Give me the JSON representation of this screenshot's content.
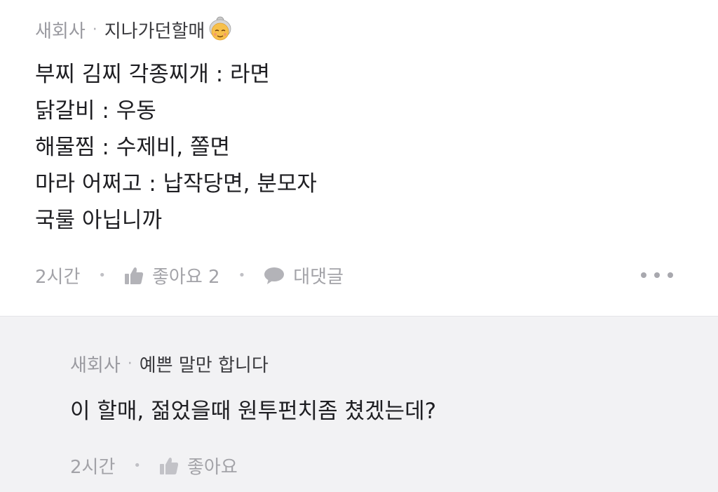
{
  "comment": {
    "company": "새회사",
    "nickname": "지나가던할매",
    "nickname_icon": "old-woman-emoji",
    "lines": [
      "부찌 김찌 각종찌개 : 라면",
      "닭갈비 : 우동",
      "해물찜 : 수제비, 쫄면",
      "마라 어쩌고 : 납작당면, 분모자",
      "국룰 아닙니까"
    ],
    "time": "2시간",
    "like_label": "좋아요 2",
    "reply_label": "대댓글"
  },
  "reply": {
    "company": "새회사",
    "nickname": "예쁜 말만 합니다",
    "text": "이 할매, 젊었을때 원투펀치좀 쳤겠는데?",
    "time": "2시간",
    "like_label": "좋아요"
  },
  "colors": {
    "reply_background": "#f2f2f4",
    "muted_text": "#a3a3a8",
    "body_text": "#1e1e22"
  }
}
